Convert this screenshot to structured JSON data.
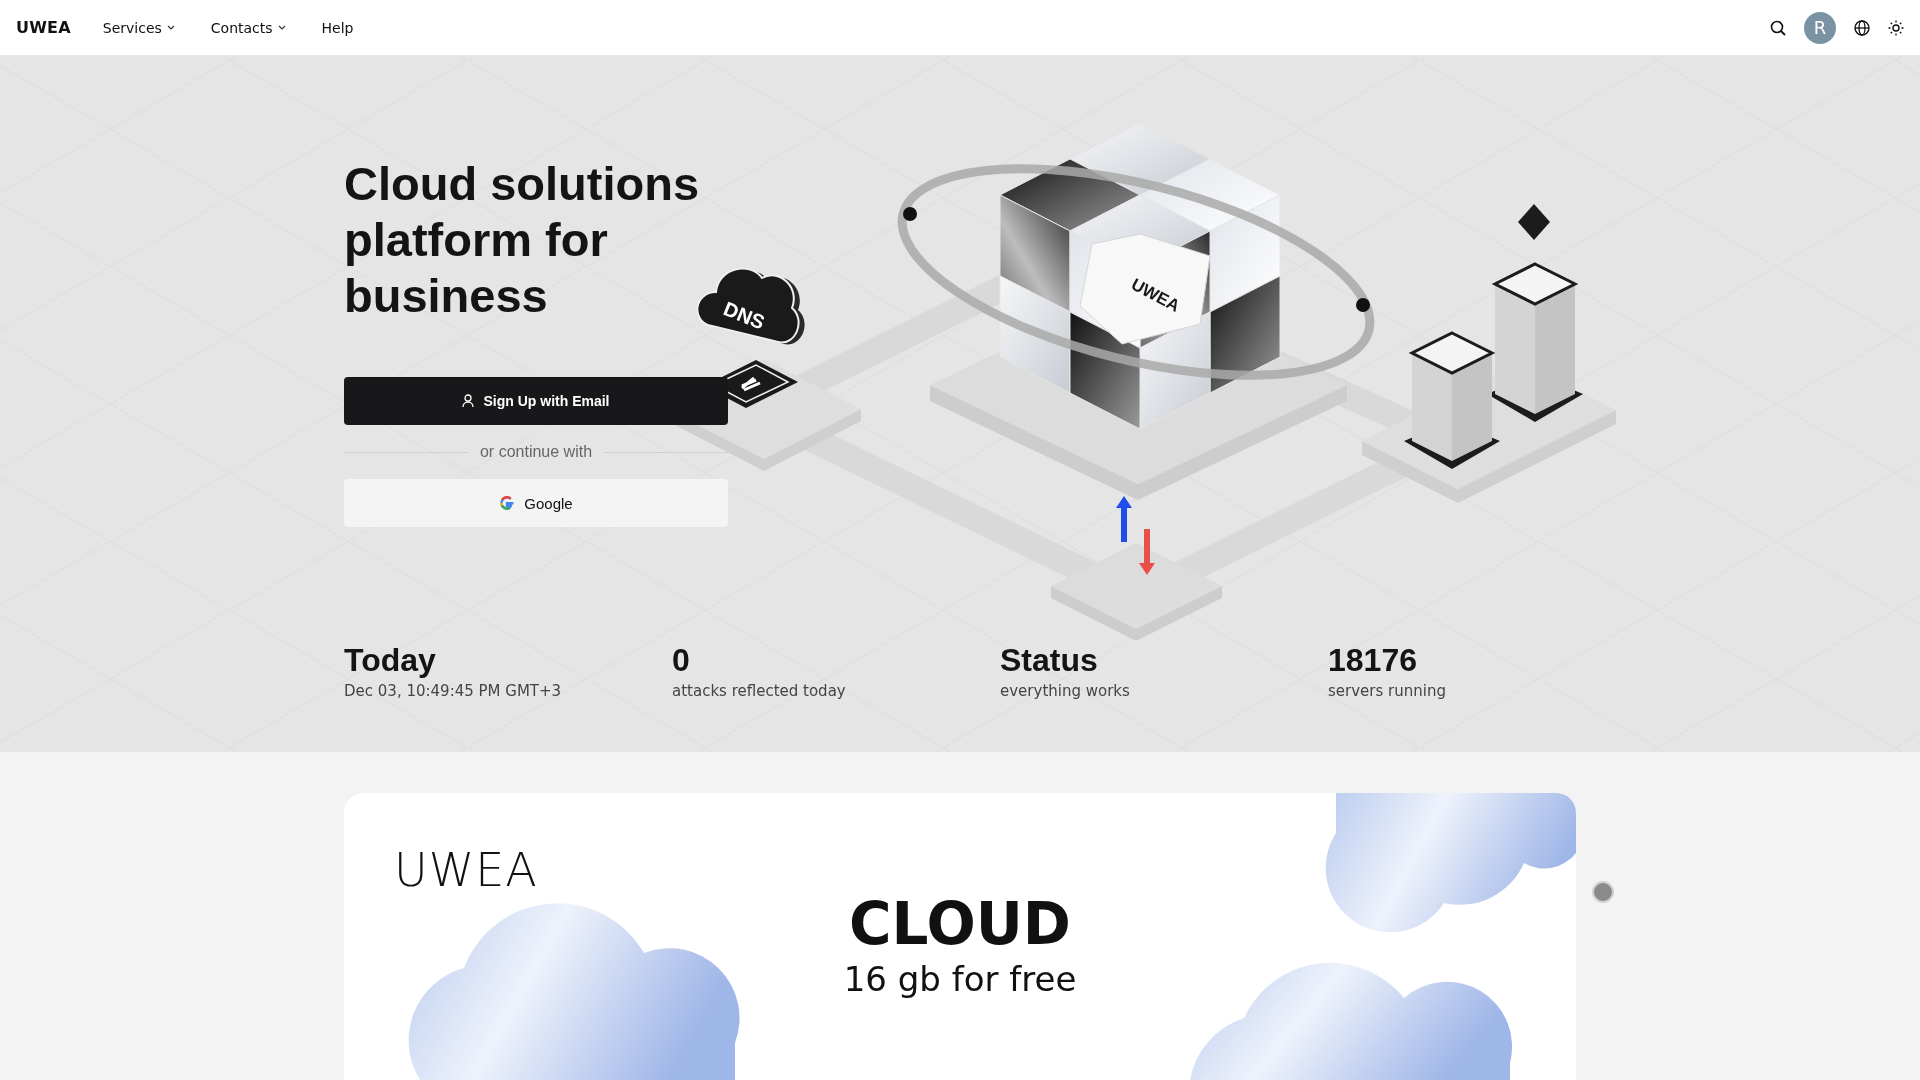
{
  "nav": {
    "logo": "UWEA",
    "items": [
      {
        "label": "Services",
        "dropdown": true
      },
      {
        "label": "Contacts",
        "dropdown": true
      },
      {
        "label": "Help",
        "dropdown": false
      }
    ],
    "avatar": "R"
  },
  "hero": {
    "title": "Cloud solutions platform for business",
    "signup_button": "Sign Up with Email",
    "divider_text": "or continue with",
    "google_button": "Google",
    "illustration": {
      "cloud_label": "DNS",
      "cube_label": "UWEA"
    }
  },
  "stats": [
    {
      "value": "Today",
      "label": "Dec 03, 10:49:45 PM GMT+3"
    },
    {
      "value": "0",
      "label": "attacks reflected today"
    },
    {
      "value": "Status",
      "label": "everything works"
    },
    {
      "value": "18176",
      "label": "servers running"
    }
  ],
  "banner": {
    "brand": "UWEA",
    "headline": "CLOUD",
    "subline": "16 gb for free"
  }
}
